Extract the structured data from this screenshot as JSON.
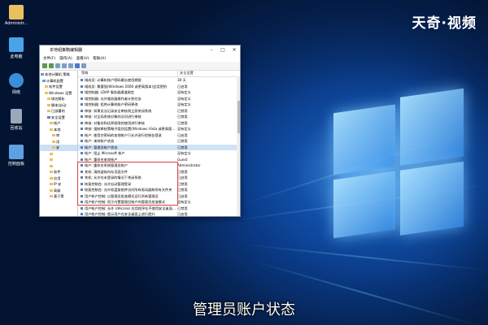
{
  "desktop": {
    "icons": [
      {
        "label": "Administr...",
        "icon": "user-folder-icon",
        "color": "#e8c060"
      },
      {
        "label": "此电脑",
        "icon": "computer-icon",
        "color": "#4aa3e8"
      },
      {
        "label": "网络",
        "icon": "network-icon",
        "color": "#3b8fd8"
      },
      {
        "label": "回收站",
        "icon": "recycle-bin-icon",
        "color": "#9aa8b8"
      },
      {
        "label": "控制面板",
        "icon": "control-panel-icon",
        "color": "#5fa0e0"
      }
    ]
  },
  "watermark": "天奇·视频",
  "subtitle": "管理员账户状态",
  "window": {
    "title": "本地组策略编辑器",
    "menu": [
      "文件(F)",
      "操作(A)",
      "查看(V)",
      "帮助(H)"
    ],
    "tree": [
      {
        "label": "本地计算机 策略"
      },
      {
        "label": "计算机配置"
      },
      {
        "label": "软件设置"
      },
      {
        "label": "Windows 设置"
      },
      {
        "label": "域名解析"
      },
      {
        "label": "脚本(启动"
      },
      {
        "label": "已部署的"
      },
      {
        "label": "安全设置"
      },
      {
        "label": "帐户"
      },
      {
        "label": "本地"
      },
      {
        "label": "审"
      },
      {
        "label": "用"
      },
      {
        "label": "安"
      },
      {
        "label": ""
      },
      {
        "label": ""
      },
      {
        "label": ""
      },
      {
        "label": "软件"
      },
      {
        "label": "应用"
      },
      {
        "label": "IP 安"
      },
      {
        "label": "高级"
      },
      {
        "label": "基于策"
      }
    ],
    "columns": {
      "policy": "策略",
      "setting": "安全设置"
    },
    "rows": [
      {
        "policy": "域成员: 计算机帐户密码最长使用期限",
        "setting": "30 天"
      },
      {
        "policy": "域成员: 需要强(Windows 2000 或更高版本)会话密钥",
        "setting": "已启用"
      },
      {
        "policy": "域控制器: LDAP 服务器通道绑定",
        "setting": "没有定义"
      },
      {
        "policy": "域控制器: 允许服务器操作者计划任务",
        "setting": "没有定义"
      },
      {
        "policy": "域控制器: 拒绝计算机帐户密码更改",
        "setting": "没有定义"
      },
      {
        "policy": "审核: 如果无法记录安全审核则立即关闭系统",
        "setting": "已禁用"
      },
      {
        "policy": "审核: 对全局系统对象的访问进行审核",
        "setting": "已禁用"
      },
      {
        "policy": "审核: 对备份和还原权限的使用进行审核",
        "setting": "已禁用"
      },
      {
        "policy": "审核: 强制审核策略子类别设置(Windows Vista 或更高版本)以",
        "setting": "没有定义"
      },
      {
        "policy": "帐户: 使用空密码的本地帐户只允许进行控制台登录",
        "setting": "已启用"
      },
      {
        "policy": "帐户: 来宾帐户状态",
        "setting": "已禁用"
      },
      {
        "policy": "帐户: 管理员帐户状态",
        "setting": "已禁用"
      },
      {
        "policy": "帐户: 阻止 Microsoft 帐户",
        "setting": "没有定义"
      },
      {
        "policy": "帐户: 重命名来宾帐户",
        "setting": "Guest"
      },
      {
        "policy": "帐户: 重命名系统管理员帐户",
        "setting": "Administrator"
      },
      {
        "policy": "关机: 清除虚拟内存页面文件",
        "setting": "已禁用"
      },
      {
        "policy": "关机: 允许在未登录的情况下关闭系统",
        "setting": "已启用"
      },
      {
        "policy": "恢复控制台: 允许自动管理登录",
        "setting": "已禁用"
      },
      {
        "policy": "恢复控制台: 允许软盘复制并访问所有驱动器和所有文件夹",
        "setting": "已禁用"
      },
      {
        "policy": "用户帐户控制: 以管理员批准模式运行所有管理员",
        "setting": "已启用"
      },
      {
        "policy": "用户帐户控制: 用于内置管理员帐户的管理员批准模式",
        "setting": "没有定义"
      },
      {
        "policy": "用户帐户控制: 允许 UIAccess 应用程序在不使用安全桌面的情况下提升权限",
        "setting": "已禁用"
      },
      {
        "policy": "用户帐户控制: 提示用户在安全桌面上进行提升",
        "setting": "已启用"
      }
    ]
  }
}
